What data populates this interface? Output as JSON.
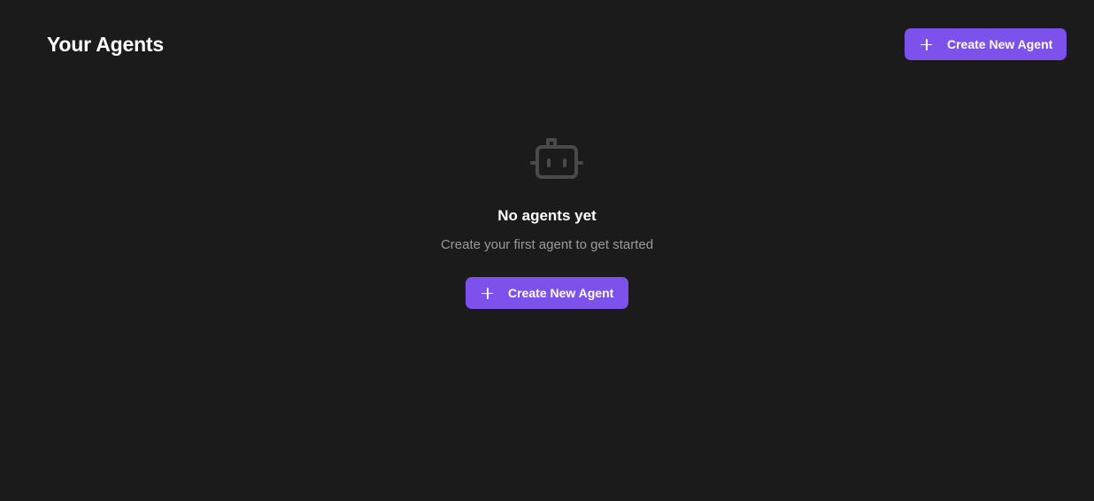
{
  "header": {
    "title": "Your Agents",
    "create_button_label": "Create New Agent",
    "create_button_icon": "plus-icon"
  },
  "empty_state": {
    "icon": "robot-icon",
    "title": "No agents yet",
    "subtitle": "Create your first agent to get started",
    "create_button_label": "Create New Agent",
    "create_button_icon": "plus-icon"
  },
  "colors": {
    "background": "#1b1b1c",
    "accent": "#7c51ec",
    "muted_text": "#9a9a9a",
    "icon_gray": "#4a4a4a"
  }
}
